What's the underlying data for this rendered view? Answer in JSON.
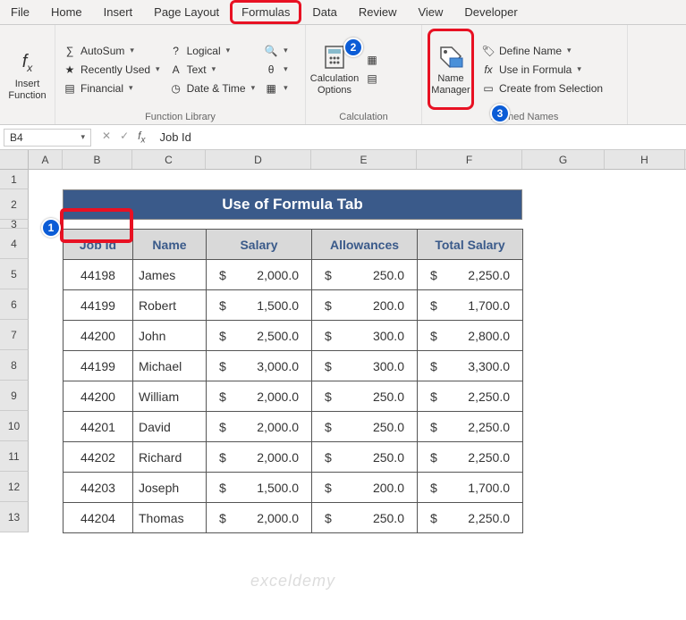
{
  "menu": {
    "tabs": [
      "File",
      "Home",
      "Insert",
      "Page Layout",
      "Formulas",
      "Data",
      "Review",
      "View",
      "Developer"
    ],
    "active": "Formulas"
  },
  "ribbon": {
    "insert_fn": "Insert\nFunction",
    "autosum": "AutoSum",
    "recent": "Recently Used",
    "financial": "Financial",
    "logical": "Logical",
    "text": "Text",
    "datetime": "Date & Time",
    "calc_options": "Calculation\nOptions",
    "name_manager": "Name\nManager",
    "define_name": "Define Name",
    "use_formula": "Use in Formula",
    "create_sel": "Create from Selection",
    "grp_lib": "Function Library",
    "grp_calc": "Calculation",
    "grp_names": "Defined Names"
  },
  "formula_bar": {
    "cell": "B4",
    "value": "Job Id"
  },
  "columns": [
    "A",
    "B",
    "C",
    "D",
    "E",
    "F",
    "G",
    "H"
  ],
  "rows": [
    "1",
    "2",
    "3",
    "4",
    "5",
    "6",
    "7",
    "8",
    "9",
    "10",
    "11",
    "12",
    "13"
  ],
  "title": "Use of Formula Tab",
  "headers": {
    "b": "Job Id",
    "c": "Name",
    "d": "Salary",
    "e": "Allowances",
    "f": "Total Salary"
  },
  "data": [
    {
      "id": "44198",
      "name": "James",
      "sal": "2,000.0",
      "allow": "250.0",
      "total": "2,250.0"
    },
    {
      "id": "44199",
      "name": "Robert",
      "sal": "1,500.0",
      "allow": "200.0",
      "total": "1,700.0"
    },
    {
      "id": "44200",
      "name": "John",
      "sal": "2,500.0",
      "allow": "300.0",
      "total": "2,800.0"
    },
    {
      "id": "44199",
      "name": "Michael",
      "sal": "3,000.0",
      "allow": "300.0",
      "total": "3,300.0"
    },
    {
      "id": "44200",
      "name": "William",
      "sal": "2,000.0",
      "allow": "250.0",
      "total": "2,250.0"
    },
    {
      "id": "44201",
      "name": "David",
      "sal": "2,000.0",
      "allow": "250.0",
      "total": "2,250.0"
    },
    {
      "id": "44202",
      "name": "Richard",
      "sal": "2,000.0",
      "allow": "250.0",
      "total": "2,250.0"
    },
    {
      "id": "44203",
      "name": "Joseph",
      "sal": "1,500.0",
      "allow": "200.0",
      "total": "1,700.0"
    },
    {
      "id": "44204",
      "name": "Thomas",
      "sal": "2,000.0",
      "allow": "250.0",
      "total": "2,250.0"
    }
  ],
  "watermark": "exceldemy"
}
